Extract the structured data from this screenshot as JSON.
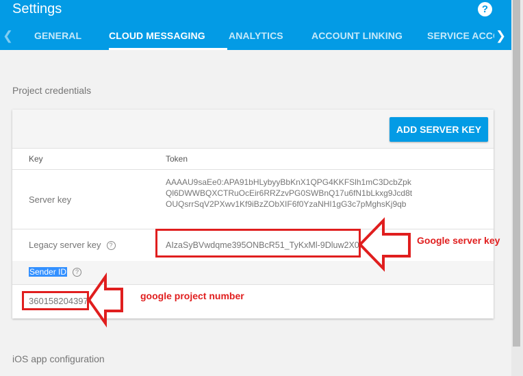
{
  "header": {
    "title": "Settings",
    "help_label": "?",
    "tabs": [
      {
        "label": "GENERAL",
        "active": false
      },
      {
        "label": "CLOUD MESSAGING",
        "active": true
      },
      {
        "label": "ANALYTICS",
        "active": false
      },
      {
        "label": "ACCOUNT LINKING",
        "active": false
      },
      {
        "label": "SERVICE ACCOUNTS",
        "active": false
      }
    ]
  },
  "credentials": {
    "section_title": "Project credentials",
    "add_button_label": "ADD SERVER KEY",
    "columns": {
      "key": "Key",
      "token": "Token"
    },
    "server_key": {
      "label": "Server key",
      "token_lines": [
        "AAAAU9saEe0:APA91bHLybyyBbKnX1QPG4KKFSlh1mC3DcbZpk",
        "Ql6DWWBQXCTRuOcEir6RRZzvPG0SWBnQ17u6fN1bLkxg9Jcd8t",
        "OUQsrrSqV2PXwv1Kf9iBzZObXIF6f0YzaNHI1gG3c7pMghsKj9qb"
      ]
    },
    "legacy_key": {
      "label": "Legacy server key",
      "help": "?",
      "token": "AIzaSyBVwdqme395ONBcR51_TyKxMl-9Dluw2X0"
    },
    "sender": {
      "label": "Sender ID",
      "help": "?",
      "value": "360158204397"
    }
  },
  "ios_section_title": "iOS app configuration",
  "annotations": {
    "server_key_note": "Google server key",
    "project_number_note": "google project number",
    "color": "#e01e1e"
  },
  "colors": {
    "primary": "#039be5",
    "background": "#f2f2f2"
  }
}
